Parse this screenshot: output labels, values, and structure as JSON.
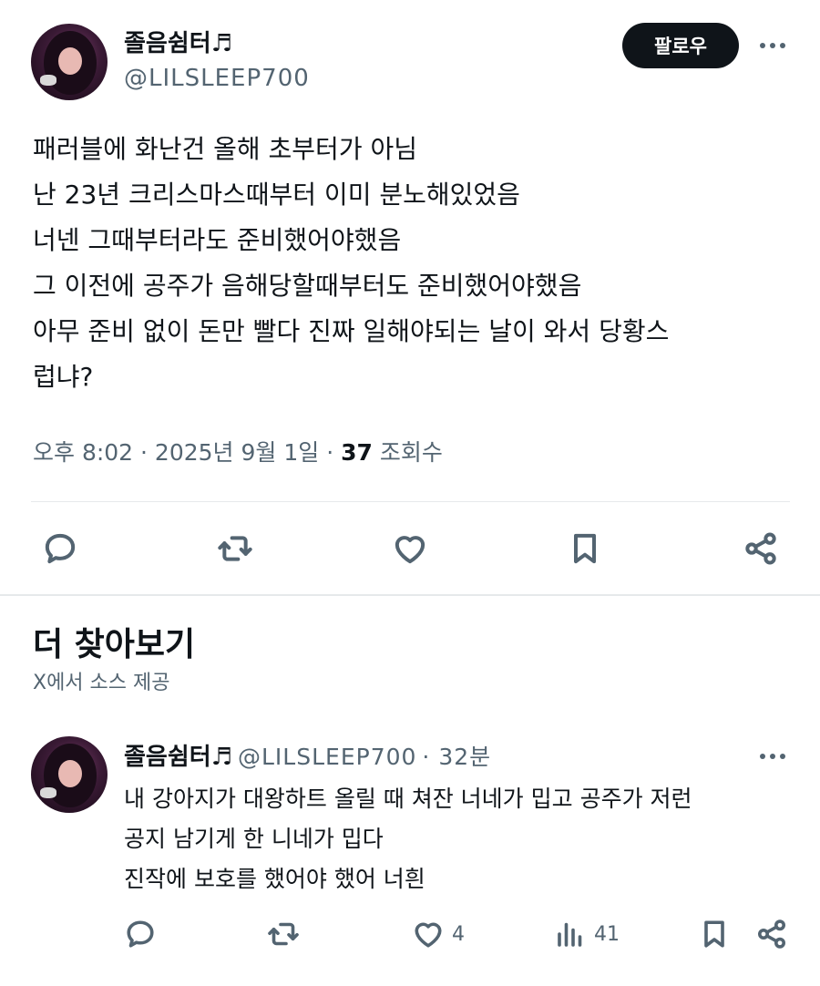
{
  "tweet": {
    "name": "졸음쉼터♬",
    "handle": "@LILSLEEP700",
    "follow_label": "팔로우",
    "lines": [
      "패러블에 화난건 올해 초부터가 아님",
      "난 23년 크리스마스때부터 이미 분노해있었음",
      "너넨 그때부터라도 준비했어야했음",
      "그 이전에 공주가 음해당할때부터도 준비했어야했음",
      "아무 준비 없이 돈만 빨다 진짜 일해야되는 날이 와서 당황스",
      "럽냐?"
    ],
    "time": "오후 8:02 · 2025년 9월 1일 ·",
    "views_count": "37",
    "views_label": "조회수",
    "actions": [
      "reply-icon",
      "retweet-icon",
      "like-icon",
      "bookmark-icon",
      "share-icon"
    ]
  },
  "more_section": {
    "title": "더 찾아보기",
    "subtitle": "X에서 소스 제공"
  },
  "reply": {
    "name": "졸음쉼터♬",
    "handle": "@LILSLEEP700",
    "time": "· 32분",
    "lines": [
      "내 강아지가 대왕하트 올릴 때 쳐잔 너네가 밉고 공주가 저런",
      "공지 남기게 한 니네가 밉다",
      "진작에 보호를 했어야 했어 너흰"
    ],
    "like_count": "4",
    "views_count": "41"
  }
}
